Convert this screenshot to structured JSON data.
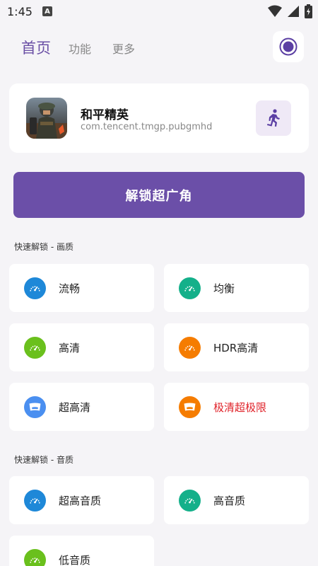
{
  "status": {
    "time": "1:45",
    "badge": "A"
  },
  "nav": {
    "tabs": [
      {
        "label": "首页",
        "active": true
      },
      {
        "label": "功能",
        "active": false
      },
      {
        "label": "更多",
        "active": false
      }
    ],
    "record_icon": "record-icon"
  },
  "game": {
    "name": "和平精英",
    "package": "com.tencent.tmgp.pubgmhd",
    "launch_icon": "running-person-icon"
  },
  "unlock_button": "解锁超广角",
  "quality_section": {
    "title": "快速解锁 - 画质",
    "options": [
      {
        "label": "流畅",
        "color": "#1e88d8",
        "icon": "gauge-icon"
      },
      {
        "label": "均衡",
        "color": "#14b08a",
        "icon": "gauge-icon"
      },
      {
        "label": "高清",
        "color": "#6ac01d",
        "icon": "gauge-icon"
      },
      {
        "label": "HDR高清",
        "color": "#f57c00",
        "icon": "gauge-icon"
      },
      {
        "label": "超高清",
        "color": "#4a8ff0",
        "icon": "widescreen-icon"
      },
      {
        "label": "极清超极限",
        "color": "#f57c00",
        "icon": "widescreen-icon",
        "highlight": "#e0242b"
      }
    ]
  },
  "sound_section": {
    "title": "快速解锁 - 音质",
    "options": [
      {
        "label": "超高音质",
        "color": "#1e88d8",
        "icon": "gauge-icon"
      },
      {
        "label": "高音质",
        "color": "#14b08a",
        "icon": "gauge-icon"
      },
      {
        "label": "低音质",
        "color": "#6ac01d",
        "icon": "gauge-icon"
      }
    ]
  }
}
